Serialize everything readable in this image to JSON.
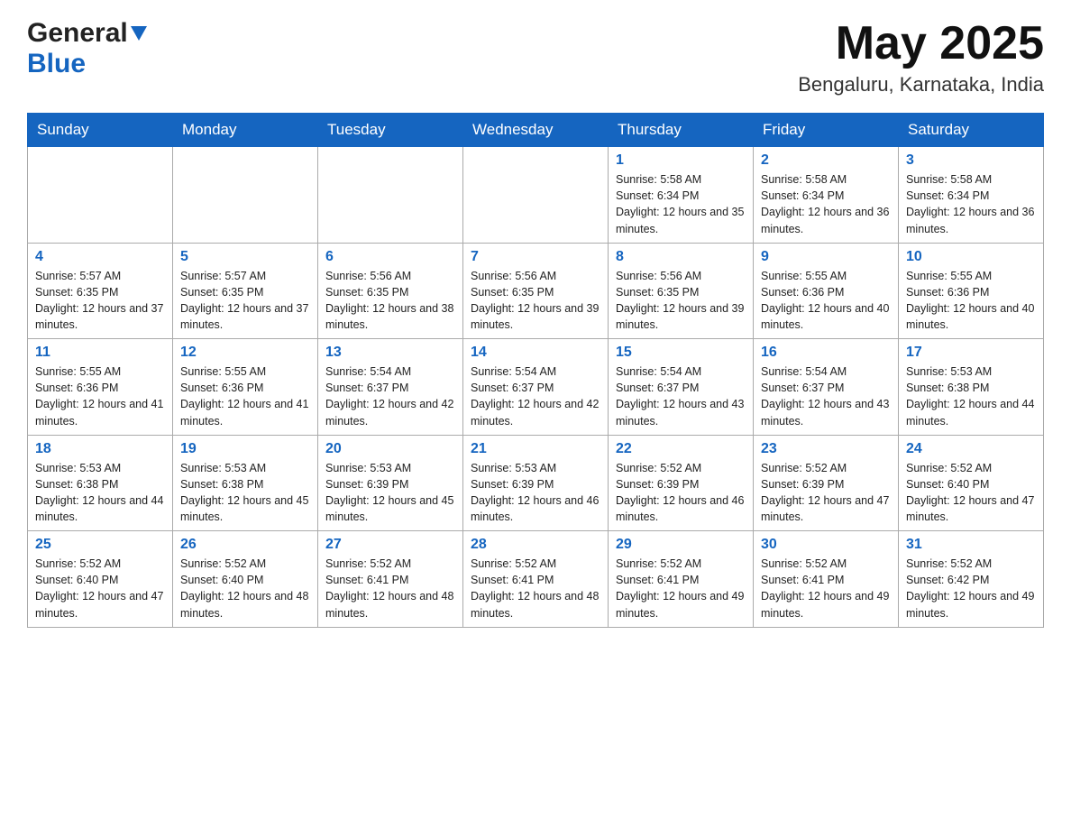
{
  "header": {
    "logo": {
      "general": "General",
      "blue": "Blue",
      "tagline": "GeneralBlue"
    },
    "month": "May 2025",
    "location": "Bengaluru, Karnataka, India"
  },
  "days_of_week": [
    "Sunday",
    "Monday",
    "Tuesday",
    "Wednesday",
    "Thursday",
    "Friday",
    "Saturday"
  ],
  "weeks": [
    [
      {
        "day": "",
        "info": ""
      },
      {
        "day": "",
        "info": ""
      },
      {
        "day": "",
        "info": ""
      },
      {
        "day": "",
        "info": ""
      },
      {
        "day": "1",
        "info": "Sunrise: 5:58 AM\nSunset: 6:34 PM\nDaylight: 12 hours and 35 minutes."
      },
      {
        "day": "2",
        "info": "Sunrise: 5:58 AM\nSunset: 6:34 PM\nDaylight: 12 hours and 36 minutes."
      },
      {
        "day": "3",
        "info": "Sunrise: 5:58 AM\nSunset: 6:34 PM\nDaylight: 12 hours and 36 minutes."
      }
    ],
    [
      {
        "day": "4",
        "info": "Sunrise: 5:57 AM\nSunset: 6:35 PM\nDaylight: 12 hours and 37 minutes."
      },
      {
        "day": "5",
        "info": "Sunrise: 5:57 AM\nSunset: 6:35 PM\nDaylight: 12 hours and 37 minutes."
      },
      {
        "day": "6",
        "info": "Sunrise: 5:56 AM\nSunset: 6:35 PM\nDaylight: 12 hours and 38 minutes."
      },
      {
        "day": "7",
        "info": "Sunrise: 5:56 AM\nSunset: 6:35 PM\nDaylight: 12 hours and 39 minutes."
      },
      {
        "day": "8",
        "info": "Sunrise: 5:56 AM\nSunset: 6:35 PM\nDaylight: 12 hours and 39 minutes."
      },
      {
        "day": "9",
        "info": "Sunrise: 5:55 AM\nSunset: 6:36 PM\nDaylight: 12 hours and 40 minutes."
      },
      {
        "day": "10",
        "info": "Sunrise: 5:55 AM\nSunset: 6:36 PM\nDaylight: 12 hours and 40 minutes."
      }
    ],
    [
      {
        "day": "11",
        "info": "Sunrise: 5:55 AM\nSunset: 6:36 PM\nDaylight: 12 hours and 41 minutes."
      },
      {
        "day": "12",
        "info": "Sunrise: 5:55 AM\nSunset: 6:36 PM\nDaylight: 12 hours and 41 minutes."
      },
      {
        "day": "13",
        "info": "Sunrise: 5:54 AM\nSunset: 6:37 PM\nDaylight: 12 hours and 42 minutes."
      },
      {
        "day": "14",
        "info": "Sunrise: 5:54 AM\nSunset: 6:37 PM\nDaylight: 12 hours and 42 minutes."
      },
      {
        "day": "15",
        "info": "Sunrise: 5:54 AM\nSunset: 6:37 PM\nDaylight: 12 hours and 43 minutes."
      },
      {
        "day": "16",
        "info": "Sunrise: 5:54 AM\nSunset: 6:37 PM\nDaylight: 12 hours and 43 minutes."
      },
      {
        "day": "17",
        "info": "Sunrise: 5:53 AM\nSunset: 6:38 PM\nDaylight: 12 hours and 44 minutes."
      }
    ],
    [
      {
        "day": "18",
        "info": "Sunrise: 5:53 AM\nSunset: 6:38 PM\nDaylight: 12 hours and 44 minutes."
      },
      {
        "day": "19",
        "info": "Sunrise: 5:53 AM\nSunset: 6:38 PM\nDaylight: 12 hours and 45 minutes."
      },
      {
        "day": "20",
        "info": "Sunrise: 5:53 AM\nSunset: 6:39 PM\nDaylight: 12 hours and 45 minutes."
      },
      {
        "day": "21",
        "info": "Sunrise: 5:53 AM\nSunset: 6:39 PM\nDaylight: 12 hours and 46 minutes."
      },
      {
        "day": "22",
        "info": "Sunrise: 5:52 AM\nSunset: 6:39 PM\nDaylight: 12 hours and 46 minutes."
      },
      {
        "day": "23",
        "info": "Sunrise: 5:52 AM\nSunset: 6:39 PM\nDaylight: 12 hours and 47 minutes."
      },
      {
        "day": "24",
        "info": "Sunrise: 5:52 AM\nSunset: 6:40 PM\nDaylight: 12 hours and 47 minutes."
      }
    ],
    [
      {
        "day": "25",
        "info": "Sunrise: 5:52 AM\nSunset: 6:40 PM\nDaylight: 12 hours and 47 minutes."
      },
      {
        "day": "26",
        "info": "Sunrise: 5:52 AM\nSunset: 6:40 PM\nDaylight: 12 hours and 48 minutes."
      },
      {
        "day": "27",
        "info": "Sunrise: 5:52 AM\nSunset: 6:41 PM\nDaylight: 12 hours and 48 minutes."
      },
      {
        "day": "28",
        "info": "Sunrise: 5:52 AM\nSunset: 6:41 PM\nDaylight: 12 hours and 48 minutes."
      },
      {
        "day": "29",
        "info": "Sunrise: 5:52 AM\nSunset: 6:41 PM\nDaylight: 12 hours and 49 minutes."
      },
      {
        "day": "30",
        "info": "Sunrise: 5:52 AM\nSunset: 6:41 PM\nDaylight: 12 hours and 49 minutes."
      },
      {
        "day": "31",
        "info": "Sunrise: 5:52 AM\nSunset: 6:42 PM\nDaylight: 12 hours and 49 minutes."
      }
    ]
  ]
}
